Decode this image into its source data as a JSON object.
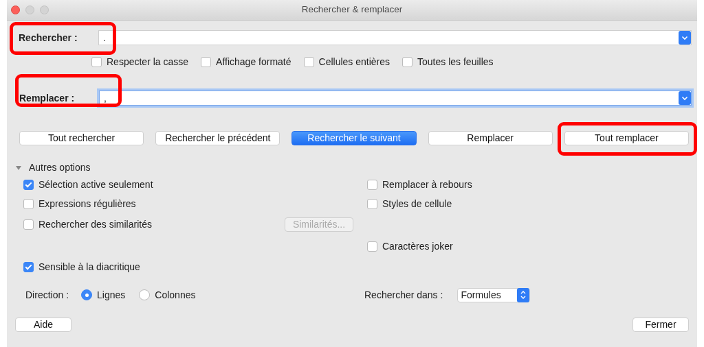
{
  "window": {
    "title": "Rechercher & remplacer"
  },
  "search": {
    "label": "Rechercher :",
    "value": ".",
    "focused": false,
    "highlighted": true
  },
  "search_options": [
    {
      "label": "Respecter la casse",
      "checked": false
    },
    {
      "label": "Affichage formaté",
      "checked": false
    },
    {
      "label": "Cellules entières",
      "checked": false
    },
    {
      "label": "Toutes les feuilles",
      "checked": false
    }
  ],
  "replace": {
    "label": "Remplacer :",
    "value": ",",
    "focused": true,
    "highlighted": true
  },
  "actions": [
    {
      "label": "Tout rechercher",
      "default": false,
      "highlighted": false
    },
    {
      "label": "Rechercher le précédent",
      "default": false,
      "highlighted": false
    },
    {
      "label": "Rechercher le suivant",
      "default": true,
      "highlighted": false
    },
    {
      "label": "Remplacer",
      "default": false,
      "highlighted": false
    },
    {
      "label": "Tout remplacer",
      "default": false,
      "highlighted": true
    }
  ],
  "more_options": {
    "label": "Autres options",
    "expanded": true,
    "rows": [
      {
        "left": {
          "label": "Sélection active seulement",
          "checked": true
        },
        "right": {
          "label": "Remplacer à rebours",
          "checked": false
        }
      },
      {
        "left": {
          "label": "Expressions régulières",
          "checked": false
        },
        "right": {
          "label": "Styles de cellule",
          "checked": false
        }
      },
      {
        "left": {
          "label": "Rechercher des similarités",
          "checked": false
        },
        "button": {
          "label": "Similarités...",
          "disabled": true
        }
      },
      {
        "right": {
          "label": "Caractères joker",
          "checked": false
        }
      },
      {
        "left": {
          "label": "Sensible à la diacritique",
          "checked": true
        }
      }
    ],
    "direction": {
      "label": "Direction :",
      "choices": [
        {
          "label": "Lignes",
          "selected": true
        },
        {
          "label": "Colonnes",
          "selected": false
        }
      ]
    },
    "search_in": {
      "label": "Rechercher dans :",
      "value": "Formules"
    }
  },
  "footer": {
    "help": "Aide",
    "close": "Fermer"
  }
}
